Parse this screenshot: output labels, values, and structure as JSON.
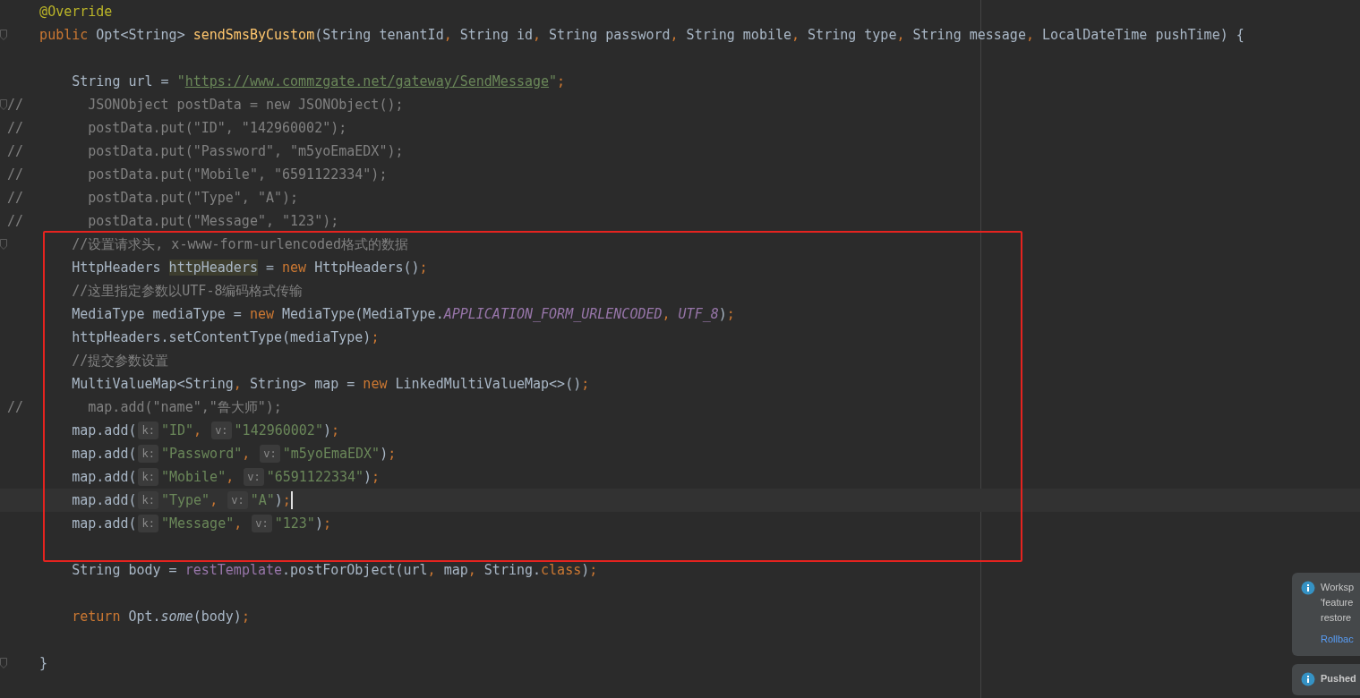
{
  "editor": {
    "lines": [
      {
        "current": false,
        "fold": false,
        "tokens": [
          {
            "kind": "annot",
            "text": "@Override"
          }
        ]
      },
      {
        "current": false,
        "fold": true,
        "tokens": [
          {
            "kind": "kw",
            "text": "public"
          },
          {
            "kind": "plain",
            "text": " Opt<String> "
          },
          {
            "kind": "decl",
            "text": "sendSmsByCustom"
          },
          {
            "kind": "plain",
            "text": "(String tenantId"
          },
          {
            "kind": "punct",
            "text": ", "
          },
          {
            "kind": "plain",
            "text": "String id"
          },
          {
            "kind": "punct",
            "text": ", "
          },
          {
            "kind": "plain",
            "text": "String password"
          },
          {
            "kind": "punct",
            "text": ", "
          },
          {
            "kind": "plain",
            "text": "String mobile"
          },
          {
            "kind": "punct",
            "text": ", "
          },
          {
            "kind": "plain",
            "text": "String type"
          },
          {
            "kind": "punct",
            "text": ", "
          },
          {
            "kind": "plain",
            "text": "String message"
          },
          {
            "kind": "punct",
            "text": ", "
          },
          {
            "kind": "plain",
            "text": "LocalDateTime pushTime) {"
          }
        ],
        "children": [
          {
            "current": false,
            "fold": false
          },
          {
            "current": false,
            "fold": false,
            "tokens": [
              {
                "kind": "plain",
                "text": "String url = "
              },
              {
                "kind": "str",
                "text": "\""
              },
              {
                "kind": "link",
                "text": "https://www.commzgate.net/gateway/SendMessage"
              },
              {
                "kind": "str",
                "text": "\""
              },
              {
                "kind": "punct",
                "text": ";"
              }
            ]
          },
          {
            "current": false,
            "fold": true,
            "prefix": "//",
            "tokens": [
              {
                "kind": "comment",
                "text": "JSONObject postData = new JSONObject();"
              }
            ]
          },
          {
            "current": false,
            "fold": false,
            "prefix": "//",
            "tokens": [
              {
                "kind": "comment",
                "text": "postData.put(\"ID\", \"142960002\");"
              }
            ]
          },
          {
            "current": false,
            "fold": false,
            "prefix": "//",
            "tokens": [
              {
                "kind": "comment",
                "text": "postData.put(\"Password\", \"m5yoEmaEDX\");"
              }
            ]
          },
          {
            "current": false,
            "fold": false,
            "prefix": "//",
            "tokens": [
              {
                "kind": "comment",
                "text": "postData.put(\"Mobile\", \"6591122334\");"
              }
            ]
          },
          {
            "current": false,
            "fold": false,
            "prefix": "//",
            "tokens": [
              {
                "kind": "comment",
                "text": "postData.put(\"Type\", \"A\");"
              }
            ]
          },
          {
            "current": false,
            "fold": false,
            "prefix": "//",
            "tokens": [
              {
                "kind": "comment",
                "text": "postData.put(\"Message\", \"123\");"
              }
            ]
          },
          {
            "current": false,
            "fold": true,
            "tokens": [
              {
                "kind": "comment",
                "text": "//设置请求头, x-www-form-urlencoded格式的数据"
              }
            ]
          },
          {
            "current": false,
            "fold": false,
            "tokens": [
              {
                "kind": "plain",
                "text": "HttpHeaders "
              },
              {
                "kind": "hl",
                "text": "httpHeaders"
              },
              {
                "kind": "plain",
                "text": " = "
              },
              {
                "kind": "kw",
                "text": "new"
              },
              {
                "kind": "plain",
                "text": " HttpHeaders()"
              },
              {
                "kind": "punct",
                "text": ";"
              }
            ]
          },
          {
            "current": false,
            "fold": false,
            "tokens": [
              {
                "kind": "comment",
                "text": "//这里指定参数以UTF-8编码格式传输"
              }
            ]
          },
          {
            "current": false,
            "fold": false,
            "tokens": [
              {
                "kind": "plain",
                "text": "MediaType mediaType = "
              },
              {
                "kind": "kw",
                "text": "new"
              },
              {
                "kind": "plain",
                "text": " MediaType(MediaType."
              },
              {
                "kind": "field",
                "text": "APPLICATION_FORM_URLENCODED"
              },
              {
                "kind": "punct",
                "text": ", "
              },
              {
                "kind": "field",
                "text": "UTF_8"
              },
              {
                "kind": "plain",
                "text": ")"
              },
              {
                "kind": "punct",
                "text": ";"
              }
            ]
          },
          {
            "current": false,
            "fold": false,
            "tokens": [
              {
                "kind": "plain",
                "text": "httpHeaders.setContentType(mediaType)"
              },
              {
                "kind": "punct",
                "text": ";"
              }
            ]
          },
          {
            "current": false,
            "fold": false,
            "tokens": [
              {
                "kind": "comment",
                "text": "//提交参数设置"
              }
            ]
          },
          {
            "current": false,
            "fold": false,
            "tokens": [
              {
                "kind": "plain",
                "text": "MultiValueMap<String"
              },
              {
                "kind": "punct",
                "text": ", "
              },
              {
                "kind": "plain",
                "text": "String> map = "
              },
              {
                "kind": "kw",
                "text": "new"
              },
              {
                "kind": "plain",
                "text": " LinkedMultiValueMap<>()"
              },
              {
                "kind": "punct",
                "text": ";"
              }
            ]
          },
          {
            "current": false,
            "fold": false,
            "prefix": "//",
            "tokens": [
              {
                "kind": "comment",
                "text": "map.add(\"name\",\"鲁大师\");"
              }
            ]
          },
          {
            "current": false,
            "fold": false,
            "tokens": [
              {
                "kind": "plain",
                "text": "map.add("
              },
              {
                "kind": "hint",
                "text": "k:"
              },
              {
                "kind": "str",
                "text": "\"ID\""
              },
              {
                "kind": "punct",
                "text": ", "
              },
              {
                "kind": "hint",
                "text": "v:"
              },
              {
                "kind": "str",
                "text": "\"142960002\""
              },
              {
                "kind": "plain",
                "text": ")"
              },
              {
                "kind": "punct",
                "text": ";"
              }
            ]
          },
          {
            "current": false,
            "fold": false,
            "tokens": [
              {
                "kind": "plain",
                "text": "map.add("
              },
              {
                "kind": "hint",
                "text": "k:"
              },
              {
                "kind": "str",
                "text": "\"Password\""
              },
              {
                "kind": "punct",
                "text": ", "
              },
              {
                "kind": "hint",
                "text": "v:"
              },
              {
                "kind": "str",
                "text": "\"m5yoEmaEDX\""
              },
              {
                "kind": "plain",
                "text": ")"
              },
              {
                "kind": "punct",
                "text": ";"
              }
            ]
          },
          {
            "current": false,
            "fold": false,
            "tokens": [
              {
                "kind": "plain",
                "text": "map.add("
              },
              {
                "kind": "hint",
                "text": "k:"
              },
              {
                "kind": "str",
                "text": "\"Mobile\""
              },
              {
                "kind": "punct",
                "text": ", "
              },
              {
                "kind": "hint",
                "text": "v:"
              },
              {
                "kind": "str",
                "text": "\"6591122334\""
              },
              {
                "kind": "plain",
                "text": ")"
              },
              {
                "kind": "punct",
                "text": ";"
              }
            ]
          },
          {
            "current": true,
            "fold": false,
            "tokens": [
              {
                "kind": "plain",
                "text": "map.add("
              },
              {
                "kind": "hint",
                "text": "k:"
              },
              {
                "kind": "str",
                "text": "\"Type\""
              },
              {
                "kind": "punct",
                "text": ", "
              },
              {
                "kind": "hint",
                "text": "v:"
              },
              {
                "kind": "str",
                "text": "\"A\""
              },
              {
                "kind": "plain",
                "text": ")"
              },
              {
                "kind": "punct",
                "text": ";"
              }
            ]
          },
          {
            "current": false,
            "fold": false,
            "tokens": [
              {
                "kind": "plain",
                "text": "map.add("
              },
              {
                "kind": "hint",
                "text": "k:"
              },
              {
                "kind": "str",
                "text": "\"Message\""
              },
              {
                "kind": "punct",
                "text": ", "
              },
              {
                "kind": "hint",
                "text": "v:"
              },
              {
                "kind": "str",
                "text": "\"123\""
              },
              {
                "kind": "plain",
                "text": ")"
              },
              {
                "kind": "punct",
                "text": ";"
              }
            ]
          },
          {
            "current": false,
            "fold": false
          },
          {
            "current": false,
            "fold": false,
            "tokens": [
              {
                "kind": "plain",
                "text": "String body = "
              },
              {
                "kind": "member",
                "text": "restTemplate"
              },
              {
                "kind": "plain",
                "text": ".postForObject(url"
              },
              {
                "kind": "punct",
                "text": ", "
              },
              {
                "kind": "plain",
                "text": "map"
              },
              {
                "kind": "punct",
                "text": ", "
              },
              {
                "kind": "plain",
                "text": "String."
              },
              {
                "kind": "kw",
                "text": "class"
              },
              {
                "kind": "plain",
                "text": ")"
              },
              {
                "kind": "punct",
                "text": ";"
              }
            ]
          },
          {
            "current": false,
            "fold": false
          },
          {
            "current": false,
            "fold": false,
            "tokens": [
              {
                "kind": "kw",
                "text": "return"
              },
              {
                "kind": "plain",
                "text": " Opt."
              },
              {
                "kind": "italic",
                "text": "some"
              },
              {
                "kind": "plain",
                "text": "(body)"
              },
              {
                "kind": "punct",
                "text": ";"
              }
            ]
          },
          {
            "current": false,
            "fold": false
          }
        ]
      },
      {
        "current": false,
        "fold": true,
        "tokens": [
          {
            "kind": "plain",
            "text": "}"
          }
        ]
      }
    ]
  },
  "notifications": [
    {
      "kind": "info",
      "lines": [
        "Worksp",
        "'feature",
        "restore"
      ],
      "link": "Rollbac"
    },
    {
      "kind": "info",
      "title": "Pushed"
    }
  ]
}
